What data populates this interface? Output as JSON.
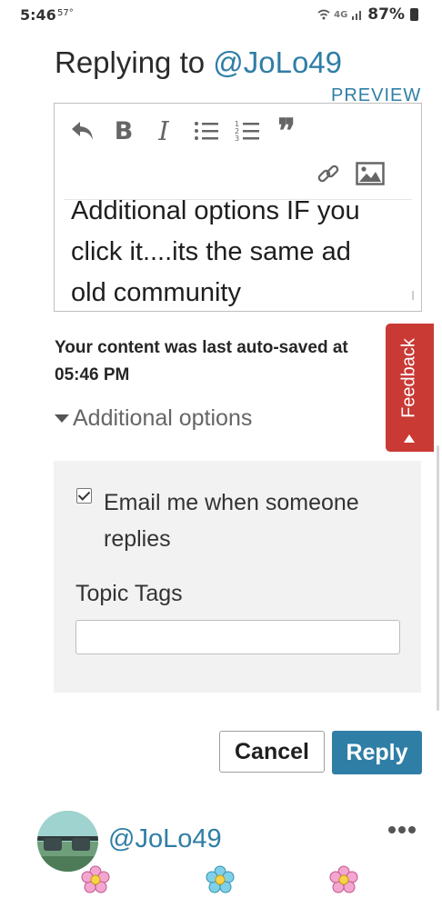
{
  "status_bar": {
    "time": "5:46",
    "temperature": "57°",
    "network": "4G",
    "battery": "87%"
  },
  "header": {
    "title_prefix": "Replying to ",
    "mention": "@JoLo49"
  },
  "preview_label": "PREVIEW",
  "editor": {
    "toolbar": [
      "reply-icon",
      "bold-icon",
      "italic-icon",
      "bulleted-list-icon",
      "numbered-list-icon",
      "quote-icon",
      "link-icon",
      "image-icon"
    ],
    "bold_glyph": "B",
    "italic_glyph": "I",
    "quote_glyph": "❞",
    "lines": [
      "Additional options IF you",
      "click it....its the same ad",
      "old community"
    ]
  },
  "autosave": {
    "line1": "Your content was last auto-saved at",
    "line2": "05:46 PM"
  },
  "additional_options": {
    "toggle_label": "Additional options",
    "email_checked": true,
    "email_label": "Email me when someone replies",
    "tags_label": "Topic Tags",
    "tags_value": ""
  },
  "actions": {
    "cancel_label": "Cancel",
    "reply_label": "Reply"
  },
  "feedback_label": "Feedback",
  "author": {
    "name": "@JoLo49"
  },
  "colors": {
    "accent": "#2f7ea6",
    "feedback": "#c93a35",
    "panel": "#f2f2f2"
  }
}
